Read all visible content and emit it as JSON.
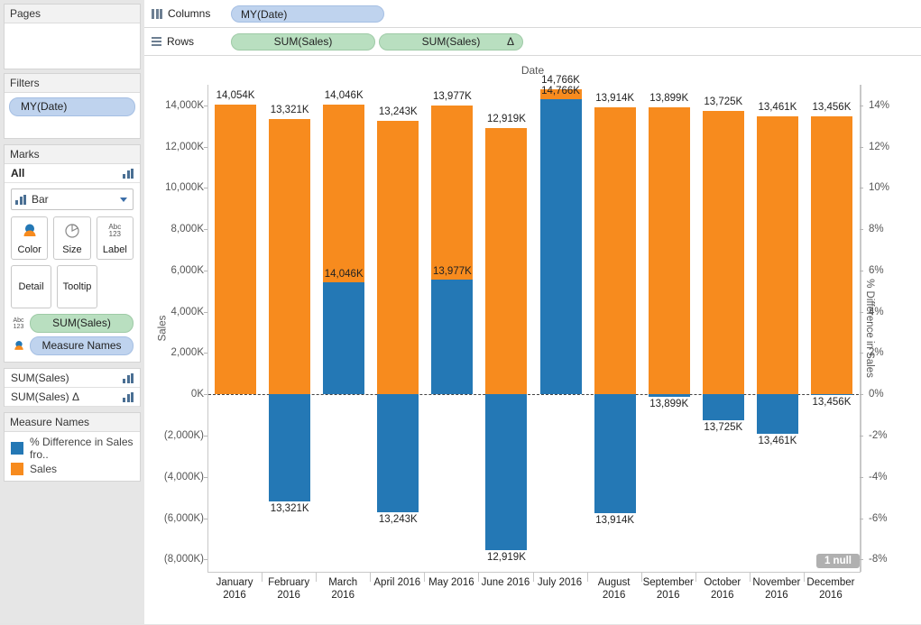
{
  "sidebar": {
    "pages": {
      "title": "Pages"
    },
    "filters": {
      "title": "Filters",
      "items": [
        {
          "label": "MY(Date)"
        }
      ]
    },
    "marks": {
      "title": "Marks",
      "all_label": "All",
      "mark_type": "Bar",
      "buttons": [
        {
          "label": "Color",
          "icon": "color-icon"
        },
        {
          "label": "Size",
          "icon": "size-icon"
        },
        {
          "label": "Label",
          "icon": "abc123-icon"
        },
        {
          "label": "Detail",
          "icon": "detail-icon"
        },
        {
          "label": "Tooltip",
          "icon": "tooltip-icon"
        }
      ],
      "shelf_items": [
        {
          "label": "SUM(Sales)",
          "icon": "abc123-icon",
          "pill": "green"
        },
        {
          "label": "Measure Names",
          "icon": "color-icon",
          "pill": "blue"
        }
      ]
    },
    "mark_rows": [
      {
        "label": "SUM(Sales)",
        "icon": "bar-chart-icon"
      },
      {
        "label": "SUM(Sales) Δ",
        "icon": "bar-chart-icon"
      }
    ],
    "legend": {
      "title": "Measure Names",
      "entries": [
        {
          "label": "% Difference in Sales fro..",
          "color": "#2478b5"
        },
        {
          "label": "Sales",
          "color": "#f78b1e"
        }
      ]
    }
  },
  "shelves": {
    "columns": {
      "label": "Columns",
      "pills": [
        {
          "label": "MY(Date)",
          "type": "blue"
        }
      ]
    },
    "rows": {
      "label": "Rows",
      "pills": [
        {
          "label": "SUM(Sales)",
          "type": "green",
          "badge": ""
        },
        {
          "label": "SUM(Sales)",
          "type": "green",
          "badge": "Δ"
        }
      ]
    }
  },
  "chart_data": {
    "type": "bar",
    "title": "Date",
    "xlabel": "Date",
    "ylabel": "Sales",
    "y2label": "% Difference in Sales",
    "ylim": [
      -8000,
      15000
    ],
    "y2lim": [
      -8,
      15
    ],
    "grid": false,
    "legend_position": "left-panel",
    "null_badge": "1 null",
    "yticks": [
      "14,000K",
      "12,000K",
      "10,000K",
      "8,000K",
      "6,000K",
      "4,000K",
      "2,000K",
      "0K",
      "(2,000K)",
      "(4,000K)",
      "(6,000K)",
      "(8,000K)"
    ],
    "ytick_values": [
      14000,
      12000,
      10000,
      8000,
      6000,
      4000,
      2000,
      0,
      -2000,
      -4000,
      -6000,
      -8000
    ],
    "y2ticks": [
      "14%",
      "12%",
      "10%",
      "8%",
      "6%",
      "4%",
      "2%",
      "0%",
      "-2%",
      "-4%",
      "-6%",
      "-8%"
    ],
    "y2tick_values": [
      14,
      12,
      10,
      8,
      6,
      4,
      2,
      0,
      -2,
      -4,
      -6,
      -8
    ],
    "categories": [
      "January 2016",
      "February 2016",
      "March 2016",
      "April 2016",
      "May 2016",
      "June 2016",
      "July 2016",
      "August 2016",
      "September 2016",
      "October 2016",
      "November 2016",
      "December 2016"
    ],
    "series": [
      {
        "name": "Sales",
        "color": "#f78b1e",
        "unit": "K",
        "values": [
          14054,
          13321,
          14046,
          13243,
          13977,
          12919,
          14766,
          13914,
          13899,
          13725,
          13461,
          13456
        ],
        "labels": [
          "14,054K",
          "13,321K",
          "14,046K",
          "13,243K",
          "13,977K",
          "12,919K",
          "14,766K",
          "13,914K",
          "13,899K",
          "13,725K",
          "13,461K",
          "13,456K"
        ]
      },
      {
        "name": "% Difference in Sales from previous",
        "color": "#2478b5",
        "unit": "%",
        "values": [
          null,
          -5.21,
          5.44,
          -5.72,
          5.54,
          -7.57,
          14.29,
          -5.77,
          -0.11,
          -1.25,
          -1.92,
          -0.04
        ],
        "labels": [
          "",
          "13,321K",
          "14,046K",
          "13,243K",
          "13,977K",
          "12,919K",
          "14,766K",
          "13,914K",
          "13,899K",
          "13,725K",
          "13,461K",
          "13,456K"
        ]
      }
    ]
  }
}
